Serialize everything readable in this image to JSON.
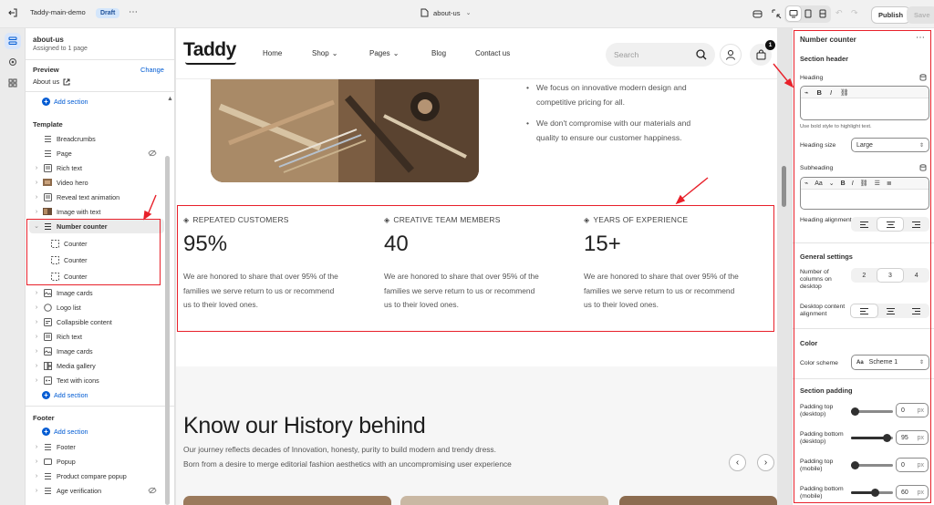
{
  "topbar": {
    "theme_name": "Taddy-main-demo",
    "status_badge": "Draft",
    "page_selector": "about-us",
    "publish_label": "Publish",
    "save_label": "Save"
  },
  "left_panel": {
    "page_title": "about-us",
    "page_subtitle": "Assigned to 1 page",
    "preview_label": "Preview",
    "preview_change": "Change",
    "preview_value": "About us",
    "add_section_top": "Add section",
    "template_heading": "Template",
    "template_items": [
      {
        "label": "Breadcrumbs",
        "expandable": false
      },
      {
        "label": "Page",
        "expandable": false,
        "hidden": true
      },
      {
        "label": "Rich text",
        "expandable": true
      },
      {
        "label": "Video hero",
        "expandable": true
      },
      {
        "label": "Reveal text animation",
        "expandable": true
      },
      {
        "label": "Image with text",
        "expandable": true
      },
      {
        "label": "Number counter",
        "expandable": true,
        "expanded": true,
        "selected": true
      }
    ],
    "counter_blocks": [
      "Counter",
      "Counter",
      "Counter"
    ],
    "template_items_after": [
      {
        "label": "Image cards"
      },
      {
        "label": "Logo list"
      },
      {
        "label": "Collapsible content"
      },
      {
        "label": "Rich text"
      },
      {
        "label": "Image cards"
      },
      {
        "label": "Media gallery"
      },
      {
        "label": "Text with icons"
      }
    ],
    "add_section_template": "Add section",
    "footer_heading": "Footer",
    "add_section_footer": "Add section",
    "footer_items": [
      {
        "label": "Footer"
      },
      {
        "label": "Popup"
      },
      {
        "label": "Product compare popup"
      },
      {
        "label": "Age verification",
        "hidden": true
      }
    ]
  },
  "site": {
    "logo": "Taddy",
    "nav": [
      "Home",
      "Shop",
      "Pages",
      "Blog",
      "Contact us"
    ],
    "nav_dropdown": [
      false,
      true,
      true,
      false,
      false
    ],
    "search_placeholder": "Search",
    "cart_count": "1",
    "bullets": [
      "We focus on innovative modern design and competitive pricing for all.",
      "We don't compromise with our materials and quality to ensure our customer happiness."
    ],
    "counters": [
      {
        "title": "REPEATED CUSTOMERS",
        "number": "95%",
        "text": "We are honored to share that over 95% of the families we serve return to us or recommend us to their loved ones."
      },
      {
        "title": "CREATIVE TEAM MEMBERS",
        "number": "40",
        "text": "We are honored to share that over 95% of the families we serve return to us or recommend us to their loved ones."
      },
      {
        "title": "YEARS OF EXPERIENCE",
        "number": "15+",
        "text": "We are honored to share that over 95% of the families we serve return to us or recommend us to their loved ones."
      }
    ],
    "history_heading": "Know our History behind",
    "history_text_1": "Our journey reflects decades of Innovation, honesty, purity to build modern and trendy dress.",
    "history_text_2": "Born from a desire to merge editorial fashion aesthetics with an uncompromising user experience"
  },
  "right_panel": {
    "title": "Number counter",
    "section_header": "Section header",
    "heading_label": "Heading",
    "heading_hint": "Use bold style to highlight text.",
    "heading_size_label": "Heading size",
    "heading_size_value": "Large",
    "subheading_label": "Subheading",
    "font_size_abbrev": "Aa",
    "heading_alignment_label": "Heading alignment",
    "general_settings": "General settings",
    "columns_label": "Number of columns on desktop",
    "columns_options": [
      "2",
      "3",
      "4"
    ],
    "columns_selected": "3",
    "desktop_alignment_label": "Desktop content alignment",
    "color_heading": "Color",
    "color_scheme_label": "Color scheme",
    "color_scheme_swatch": "Aa",
    "color_scheme_value": "Scheme 1",
    "section_padding": "Section padding",
    "padding": [
      {
        "label": "Padding top (desktop)",
        "value": "0",
        "unit": "px",
        "fraction": 0.0
      },
      {
        "label": "Padding bottom (desktop)",
        "value": "95",
        "unit": "px",
        "fraction": 0.95
      },
      {
        "label": "Padding top (mobile)",
        "value": "0",
        "unit": "px",
        "fraction": 0.0
      },
      {
        "label": "Padding bottom (mobile)",
        "value": "60",
        "unit": "px",
        "fraction": 0.6
      }
    ]
  },
  "colors": {
    "accent": "#005bd3",
    "annotation_red": "#e8202a",
    "badge_bg": "#d4e6fb"
  }
}
